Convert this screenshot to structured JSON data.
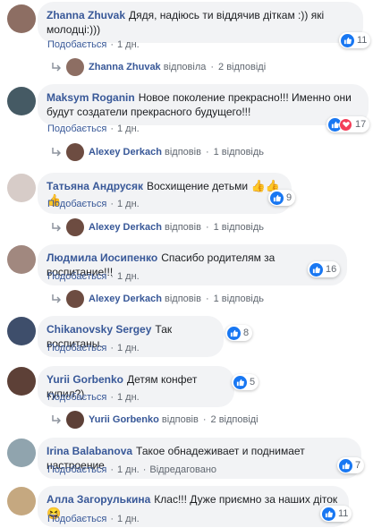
{
  "actions": {
    "like": "Подобається",
    "sep": "·",
    "edited": "Відредаговано"
  },
  "comments": [
    {
      "author": "Zhanna Zhuvak",
      "text": "Дядя, надіюсь ти віддячив діткам :)) які молодці:)))",
      "time": "1 дн.",
      "likes": "11",
      "avatar_color": "#8d6e63",
      "reactions": [
        "like"
      ],
      "reply": {
        "name": "Zhanna Zhuvak",
        "verb": "відповіла",
        "count": "2 відповіді"
      }
    },
    {
      "author": "Maksym Roganin",
      "text": "Новое поколение прекрасно!!! Именно они будут создатели прекрасного будущего!!!",
      "time": "1 дн.",
      "likes": "17",
      "avatar_color": "#455a64",
      "reactions": [
        "like",
        "love"
      ],
      "reply": {
        "name": "Alexey Derkach",
        "verb": "відповів",
        "count": "1 відповідь"
      }
    },
    {
      "author": "Татьяна Андрусяк",
      "text": "Восхищение детьми",
      "emoji": "👍👍👍",
      "time": "1 дн.",
      "likes": "9",
      "avatar_color": "#d7ccc8",
      "reactions": [
        "like"
      ],
      "reply": {
        "name": "Alexey Derkach",
        "verb": "відповів",
        "count": "1 відповідь"
      }
    },
    {
      "author": "Людмила Иосипенко",
      "text": "Спасибо родителям за воспитание!!!",
      "time": "1 дн.",
      "likes": "16",
      "avatar_color": "#a1887f",
      "reactions": [
        "like"
      ],
      "reply": {
        "name": "Alexey Derkach",
        "verb": "відповів",
        "count": "1 відповідь"
      }
    },
    {
      "author": "Chikanovsky Sergey",
      "text": "Так воспитаны.",
      "time": "1 дн.",
      "likes": "8",
      "avatar_color": "#3e4e6b",
      "reactions": [
        "like"
      ]
    },
    {
      "author": "Yurii Gorbenko",
      "text": "Детям конфет купил?)",
      "time": "1 дн.",
      "likes": "5",
      "avatar_color": "#5d4037",
      "reactions": [
        "like"
      ],
      "reply": {
        "name": "Yurii Gorbenko",
        "verb": "відповів",
        "count": "2 відповіді"
      }
    },
    {
      "author": "Irina Balabanova",
      "text": "Такое обнадеживает и поднимает настроение",
      "time": "1 дн.",
      "edited": true,
      "likes": "7",
      "avatar_color": "#90a4ae",
      "reactions": [
        "like"
      ]
    },
    {
      "author": "Алла Загорулькина",
      "text": "Клас!!! Дуже приємно за наших діток",
      "emoji": "😆",
      "time": "1 дн.",
      "likes": "11",
      "avatar_color": "#c5a880",
      "reactions": [
        "like"
      ]
    }
  ]
}
